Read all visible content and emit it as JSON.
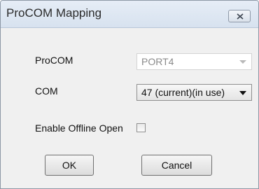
{
  "window": {
    "title": "ProCOM Mapping"
  },
  "form": {
    "procom_label": "ProCOM",
    "procom_value": "PORT4",
    "com_label": "COM",
    "com_value": "47 (current)(in use)",
    "offline_label": "Enable Offline Open",
    "offline_checked": false
  },
  "buttons": {
    "ok": "OK",
    "cancel": "Cancel"
  }
}
